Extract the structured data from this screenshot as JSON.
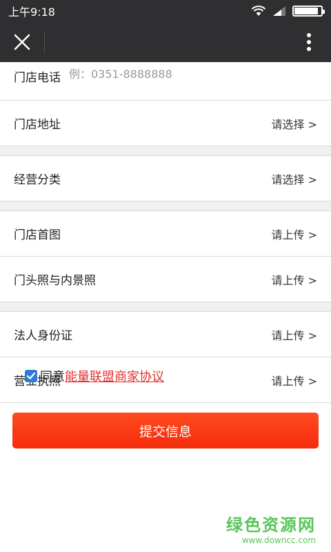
{
  "status_bar": {
    "time": "上午9:18",
    "battery_level": 0.9
  },
  "nav": {
    "close_icon": "close-icon",
    "more_icon": "more-vertical-icon"
  },
  "form": {
    "phone": {
      "label": "门店电话",
      "placeholder": "例：0351-8888888"
    },
    "address": {
      "label": "门店地址",
      "action": "请选择 >"
    },
    "category": {
      "label": "经营分类",
      "action": "请选择 >"
    },
    "cover_image": {
      "label": "门店首图",
      "action": "请上传 >"
    },
    "storefront_photos": {
      "label": "门头照与内景照",
      "action": "请上传 >"
    },
    "id_card": {
      "label": "法人身份证",
      "action": "请上传 >"
    },
    "business_license": {
      "label": "营业执照",
      "action": "请上传 >"
    }
  },
  "agreement": {
    "checked": true,
    "prefix": "同意",
    "link": "能量联盟商家协议"
  },
  "submit_label": "提交信息",
  "watermark": {
    "cn": "绿色资源网",
    "en": "www.downcc.com"
  },
  "colors": {
    "header_bg": "#2f2f31",
    "accent_red": "#f52c0c",
    "checkbox_blue": "#2e7bd6",
    "link_red": "#e0322d"
  }
}
